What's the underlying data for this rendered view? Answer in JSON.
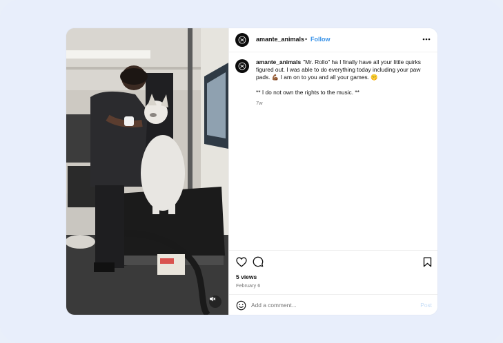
{
  "post": {
    "username": "amante_animals",
    "follow_label": "Follow",
    "separator": "•",
    "more_icon": "more-horizontal-icon"
  },
  "caption": {
    "username": "amante_animals",
    "text": "\"Mr. Rollo\" ha I finally have all your little quirks figured out. I was able to do everything today including your paw pads. 💪🏾 I am on to you and all your games. 🤫",
    "note": "** I do not own the rights to the music. **",
    "time": "7w"
  },
  "engagement": {
    "views": "5 views",
    "date": "February 6"
  },
  "comment_box": {
    "placeholder": "Add a comment...",
    "post_label": "Post"
  },
  "media": {
    "mute_icon": "muted-speaker-icon"
  },
  "colors": {
    "page_background": "#e8eefb",
    "link_blue": "#3a93e8",
    "post_disabled": "#c6ddf7",
    "muted_text": "#777777"
  }
}
